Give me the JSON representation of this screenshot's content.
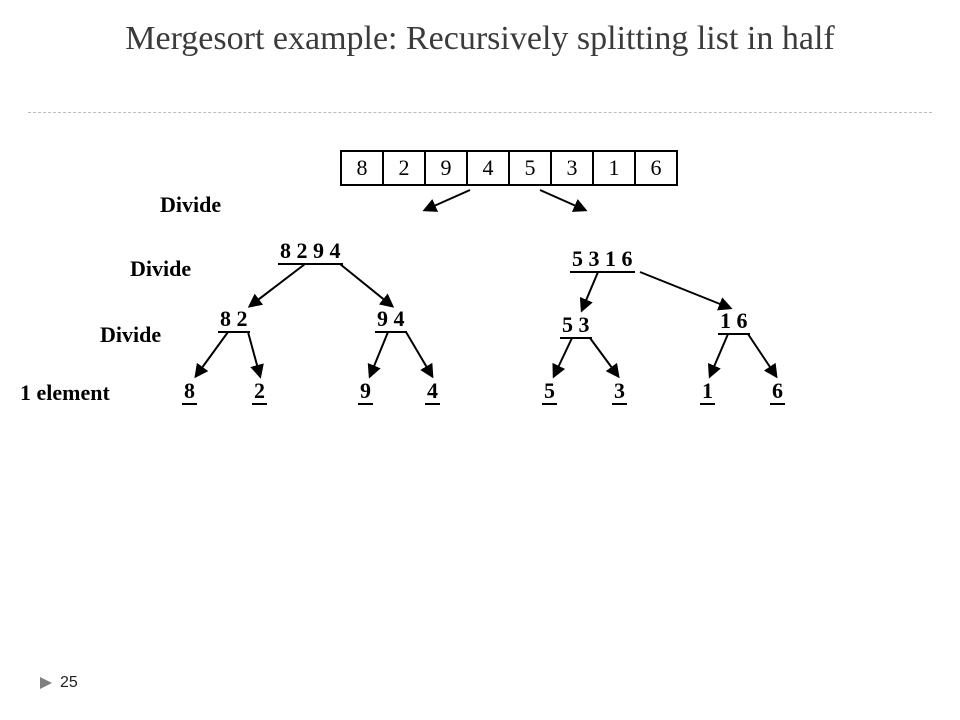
{
  "title": "Mergesort example: Recursively splitting list in half",
  "labels": {
    "divide1": "Divide",
    "divide2": "Divide",
    "divide3": "Divide",
    "leaf": "1 element"
  },
  "arrayTop": [
    "8",
    "2",
    "9",
    "4",
    "5",
    "3",
    "1",
    "6"
  ],
  "level2": {
    "left": "8  2  9  4",
    "right": "5  3  1  6"
  },
  "level3": {
    "a": "8  2",
    "b": "9  4",
    "c": "5  3",
    "d": "1  6"
  },
  "level4": {
    "v1": "8",
    "v2": "2",
    "v3": "9",
    "v4": "4",
    "v5": "5",
    "v6": "3",
    "v7": "1",
    "v8": "6"
  },
  "pageNumber": "25",
  "chart_data": {
    "type": "other",
    "description": "Mergesort recursive split tree",
    "input": [
      8,
      2,
      9,
      4,
      5,
      3,
      1,
      6
    ],
    "splits": [
      {
        "from": [
          8,
          2,
          9,
          4,
          5,
          3,
          1,
          6
        ],
        "to": [
          [
            8,
            2,
            9,
            4
          ],
          [
            5,
            3,
            1,
            6
          ]
        ],
        "label": "Divide"
      },
      {
        "from": [
          8,
          2,
          9,
          4
        ],
        "to": [
          [
            8,
            2
          ],
          [
            9,
            4
          ]
        ],
        "label": "Divide"
      },
      {
        "from": [
          5,
          3,
          1,
          6
        ],
        "to": [
          [
            5,
            3
          ],
          [
            1,
            6
          ]
        ],
        "label": "Divide"
      },
      {
        "from": [
          8,
          2
        ],
        "to": [
          [
            8
          ],
          [
            2
          ]
        ],
        "label": "Divide"
      },
      {
        "from": [
          9,
          4
        ],
        "to": [
          [
            9
          ],
          [
            4
          ]
        ],
        "label": "Divide"
      },
      {
        "from": [
          5,
          3
        ],
        "to": [
          [
            5
          ],
          [
            3
          ]
        ],
        "label": "Divide"
      },
      {
        "from": [
          1,
          6
        ],
        "to": [
          [
            1
          ],
          [
            6
          ]
        ],
        "label": "Divide"
      }
    ],
    "leafLabel": "1 element"
  }
}
